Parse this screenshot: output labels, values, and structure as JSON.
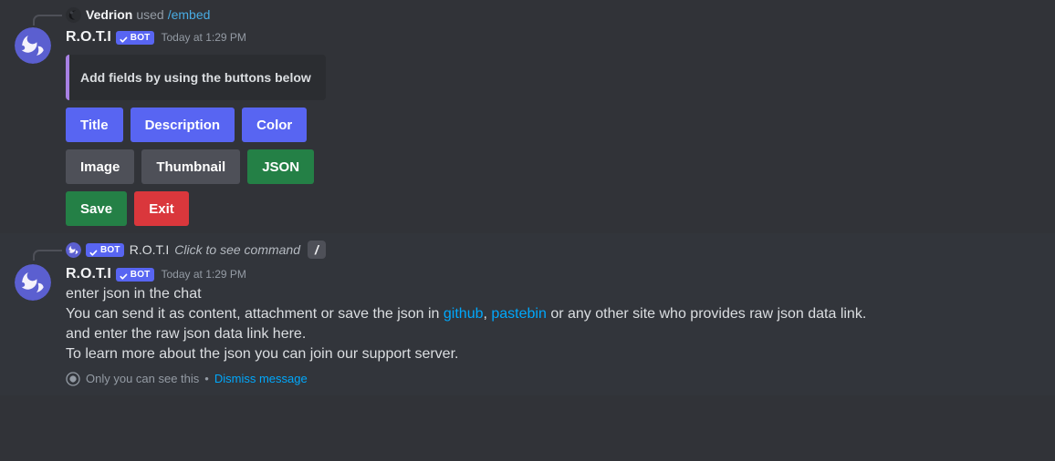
{
  "theme": {
    "bg_normal": "#313338",
    "bg_ephemeral": "#32353b",
    "blurple": "#5865f2",
    "grey_button": "#4e5058",
    "green": "#248046",
    "red": "#da373c",
    "link": "#00a8fc",
    "embed_border": "#a881e4",
    "embed_bg": "#2b2d31"
  },
  "message1": {
    "interaction": {
      "avatar_icon": "user-avatar-icon",
      "user": "Vedrion",
      "used_label": "used",
      "command": "/embed"
    },
    "author": {
      "avatar_icon": "bot-avatar-moon-icon",
      "name": "R.O.T.I",
      "bot_badge": "BOT",
      "check_icon": "check-icon",
      "timestamp": "Today at 1:29 PM"
    },
    "embed": {
      "description": "Add fields by using the buttons below"
    },
    "button_rows": [
      [
        {
          "label": "Title",
          "style": "primary"
        },
        {
          "label": "Description",
          "style": "primary"
        },
        {
          "label": "Color",
          "style": "primary"
        }
      ],
      [
        {
          "label": "Image",
          "style": "secondary"
        },
        {
          "label": "Thumbnail",
          "style": "secondary"
        },
        {
          "label": "JSON",
          "style": "success"
        }
      ],
      [
        {
          "label": "Save",
          "style": "success"
        },
        {
          "label": "Exit",
          "style": "danger"
        }
      ]
    ]
  },
  "message2": {
    "interaction": {
      "avatar_icon": "bot-avatar-moon-icon",
      "bot_badge": "BOT",
      "check_icon": "check-icon",
      "name": "R.O.T.I",
      "hint": "Click to see command",
      "slash_icon": "slash-command-icon",
      "slash_glyph": "/"
    },
    "author": {
      "avatar_icon": "bot-avatar-moon-icon",
      "name": "R.O.T.I",
      "bot_badge": "BOT",
      "check_icon": "check-icon",
      "timestamp": "Today at 1:29 PM"
    },
    "content": {
      "line1": "enter json in the chat",
      "line2_part1": "You can send it as content, attachment or save the json in ",
      "line2_link1": "github",
      "line2_sep": ", ",
      "line2_link2": "pastebin",
      "line2_part2": " or any other site who provides raw json data link.",
      "line3": "and enter the raw json data link here.",
      "line4": "To learn more about the json you can join our support server."
    },
    "footer": {
      "eye_icon": "eye-icon",
      "text": "Only you can see this",
      "separator": "•",
      "dismiss_label": "Dismiss message"
    }
  }
}
